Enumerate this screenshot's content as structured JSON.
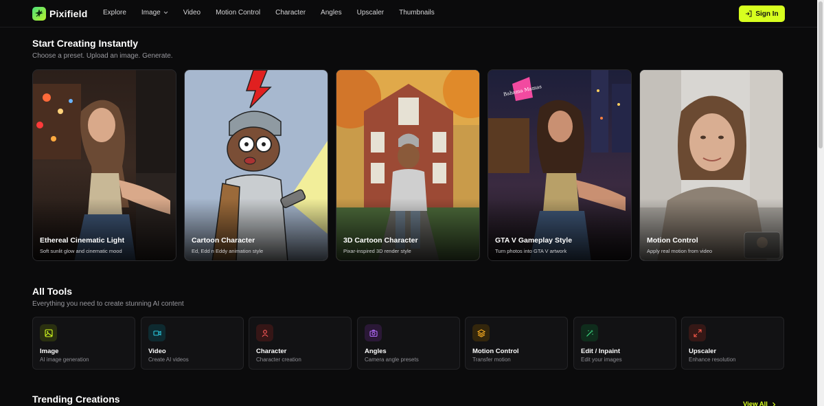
{
  "brand": {
    "name": "Pixifield",
    "accent": "#d7ff1f"
  },
  "nav": {
    "items": [
      {
        "label": "Explore"
      },
      {
        "label": "Image",
        "dropdown": true
      },
      {
        "label": "Video"
      },
      {
        "label": "Motion Control"
      },
      {
        "label": "Character"
      },
      {
        "label": "Angles"
      },
      {
        "label": "Upscaler"
      },
      {
        "label": "Thumbnails"
      }
    ],
    "sign_in": "Sign In"
  },
  "start": {
    "title": "Start Creating Instantly",
    "subtitle": "Choose a preset. Upload an image. Generate.",
    "presets": [
      {
        "title": "Ethereal Cinematic Light",
        "desc": "Soft sunlit glow and cinematic mood"
      },
      {
        "title": "Cartoon Character",
        "desc": "Ed, Edd n Eddy animation style"
      },
      {
        "title": "3D Cartoon Character",
        "desc": "Pixar-inspired 3D render style"
      },
      {
        "title": "GTA V Gameplay Style",
        "desc": "Turn photos into GTA V artwork",
        "sign_text": "Bahama Mamas"
      },
      {
        "title": "Motion Control",
        "desc": "Apply real motion from video"
      }
    ]
  },
  "tools": {
    "title": "All Tools",
    "subtitle": "Everything you need to create stunning AI content",
    "items": [
      {
        "title": "Image",
        "desc": "AI image generation",
        "icon": "image-icon",
        "color": "#d7ff1f"
      },
      {
        "title": "Video",
        "desc": "Create AI videos",
        "icon": "video-icon",
        "color": "#2bc9e0"
      },
      {
        "title": "Character",
        "desc": "Character creation",
        "icon": "person-icon",
        "color": "#ff5a5a"
      },
      {
        "title": "Angles",
        "desc": "Camera angle presets",
        "icon": "camera-icon",
        "color": "#b56bff"
      },
      {
        "title": "Motion Control",
        "desc": "Transfer motion",
        "icon": "layers-icon",
        "color": "#ffb020"
      },
      {
        "title": "Edit / Inpaint",
        "desc": "Edit your images",
        "icon": "wand-icon",
        "color": "#3ddc84"
      },
      {
        "title": "Upscaler",
        "desc": "Enhance resolution",
        "icon": "expand-icon",
        "color": "#ff5a4a"
      }
    ]
  },
  "trending": {
    "title": "Trending Creations",
    "view_all": "View All"
  }
}
